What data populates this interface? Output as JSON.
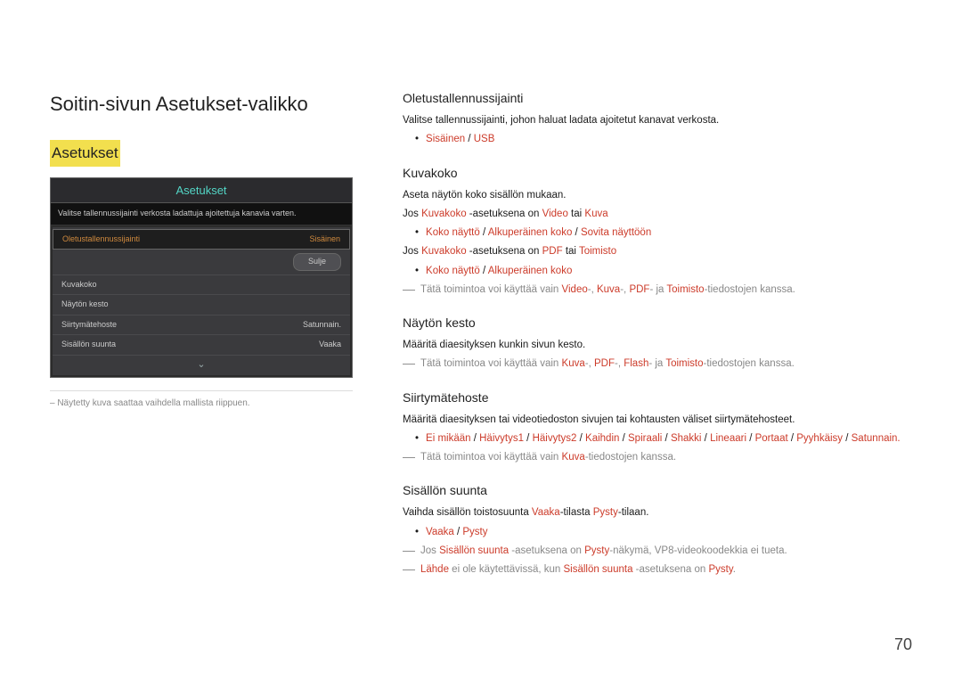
{
  "page": {
    "title": "Soitin-sivun Asetukset-valikko",
    "section": "Asetukset",
    "page_number": "70"
  },
  "panel": {
    "title": "Asetukset",
    "description": "Valitse tallennussijainti verkosta ladattuja ajoitettuja kanavia varten.",
    "rows": {
      "r1_label": "Oletustallennussijainti",
      "r1_value": "Sisäinen",
      "close_label": "Sulje",
      "r2_label": "Kuvakoko",
      "r3_label": "Näytön kesto",
      "r4_label": "Siirtymätehoste",
      "r4_value": "Satunnain.",
      "r5_label": "Sisällön suunta",
      "r5_value": "Vaaka"
    },
    "chevron": "⌄"
  },
  "img_note": "– Näytetty kuva saattaa vaihdella mallista riippuen.",
  "content": {
    "s1": {
      "head": "Oletustallennussijainti",
      "desc": "Valitse tallennussijainti, johon haluat ladata ajoitetut kanavat verkosta.",
      "bullet1a": "Sisäinen",
      "bullet1sep": " / ",
      "bullet1b": "USB"
    },
    "s2": {
      "head": "Kuvakoko",
      "desc": "Aseta näytön koko sisällön mukaan.",
      "line1_a": "Jos ",
      "line1_b": "Kuvakoko",
      "line1_c": " -asetuksena on ",
      "line1_d": "Video",
      "line1_e": " tai ",
      "line1_f": "Kuva",
      "b1a": "Koko näyttö",
      "b1b": "Alkuperäinen koko",
      "b1c": "Sovita näyttöön",
      "line2_a": "Jos ",
      "line2_b": "Kuvakoko",
      "line2_c": " -asetuksena on ",
      "line2_d": "PDF",
      "line2_e": " tai ",
      "line2_f": "Toimisto",
      "b2a": "Koko näyttö",
      "b2b": "Alkuperäinen koko",
      "note_a": "Tätä toimintoa voi käyttää vain ",
      "note_b": "Video",
      "note_c": "-, ",
      "note_d": "Kuva",
      "note_e": "-, ",
      "note_f": "PDF",
      "note_g": "- ja ",
      "note_h": "Toimisto",
      "note_i": "-tiedostojen kanssa."
    },
    "s3": {
      "head": "Näytön kesto",
      "desc": "Määritä diaesityksen kunkin sivun kesto.",
      "note_a": "Tätä toimintoa voi käyttää vain ",
      "note_b": "Kuva",
      "note_c": "-, ",
      "note_d": "PDF",
      "note_e": "-, ",
      "note_f": "Flash",
      "note_g": "- ja ",
      "note_h": "Toimisto",
      "note_i": "-tiedostojen kanssa."
    },
    "s4": {
      "head": "Siirtymätehoste",
      "desc": "Määritä diaesityksen tai videotiedoston sivujen tai kohtausten väliset siirtymätehosteet.",
      "b": {
        "a": "Ei mikään",
        "b": "Häivytys1",
        "c": "Häivytys2",
        "d": "Kaihdin",
        "e": "Spiraali",
        "f": "Shakki",
        "g": "Lineaari",
        "h": "Portaat",
        "i": "Pyyhkäisy",
        "j": "Satunnain."
      },
      "note_a": "Tätä toimintoa voi käyttää vain ",
      "note_b": "Kuva",
      "note_c": "-tiedostojen kanssa."
    },
    "s5": {
      "head": "Sisällön suunta",
      "desc_a": "Vaihda sisällön toistosuunta ",
      "desc_b": "Vaaka",
      "desc_c": "-tilasta ",
      "desc_d": "Pysty",
      "desc_e": "-tilaan.",
      "ba": "Vaaka",
      "bb": "Pysty",
      "n1_a": "Jos ",
      "n1_b": "Sisällön suunta",
      "n1_c": " -asetuksena on ",
      "n1_d": "Pysty",
      "n1_e": "-näkymä, VP8-videokoodekkia ei tueta.",
      "n2_a": "Lähde",
      "n2_b": " ei ole käytettävissä, kun ",
      "n2_c": "Sisällön suunta",
      "n2_d": " -asetuksena on ",
      "n2_e": "Pysty",
      "n2_f": "."
    }
  }
}
